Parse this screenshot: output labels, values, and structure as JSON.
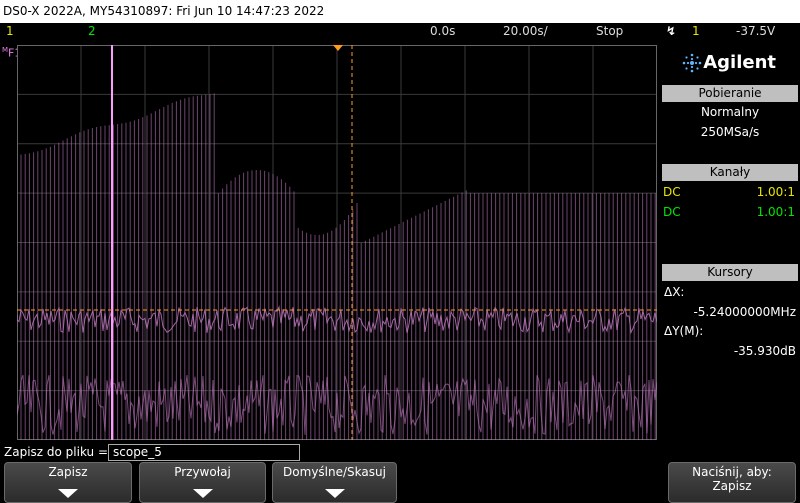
{
  "titlebar": {
    "text": "DS0-X 2022A, MY54310897: Fri Jun 10 14:47:23 2022"
  },
  "status": {
    "ch1": "1",
    "ch2": "2",
    "time_offset": "0.0s",
    "timebase": "20.00s/",
    "run_state": "Stop",
    "trigger_source": "1",
    "trigger_level": "-37.5V",
    "trigger_icon": "trigger-edge-icon"
  },
  "screen": {
    "math_label": "F1",
    "math_marker": "M"
  },
  "panel": {
    "brand": "Agilent",
    "acquisition": {
      "header": "Pobieranie",
      "mode": "Normalny",
      "rate": "250MSa/s"
    },
    "channels": {
      "header": "Kanały",
      "items": [
        {
          "coupling": "DC",
          "probe": "1.00:1",
          "color": "#e6e600"
        },
        {
          "coupling": "DC",
          "probe": "1.00:1",
          "color": "#00e600"
        }
      ]
    },
    "cursors": {
      "header": "Kursory",
      "dx_label": "ΔX:",
      "dx_value": "-5.24000000MHz",
      "dy_label": "ΔY(M):",
      "dy_value": "-35.930dB"
    }
  },
  "filebar": {
    "label": "Zapisz do pliku =",
    "value": "scope_5"
  },
  "softkeys": [
    {
      "label": "Zapisz"
    },
    {
      "label": "Przywołaj"
    },
    {
      "label": "Domyślne/Skasuj"
    },
    {
      "label_1": "Naciśnij, aby:",
      "label_2": "Zapisz"
    }
  ],
  "colors": {
    "channel1": "#e6e600",
    "channel2": "#00e600",
    "math": "#c67dc6",
    "cursor": "#ff9a1f",
    "grid": "#3a3a3a"
  }
}
